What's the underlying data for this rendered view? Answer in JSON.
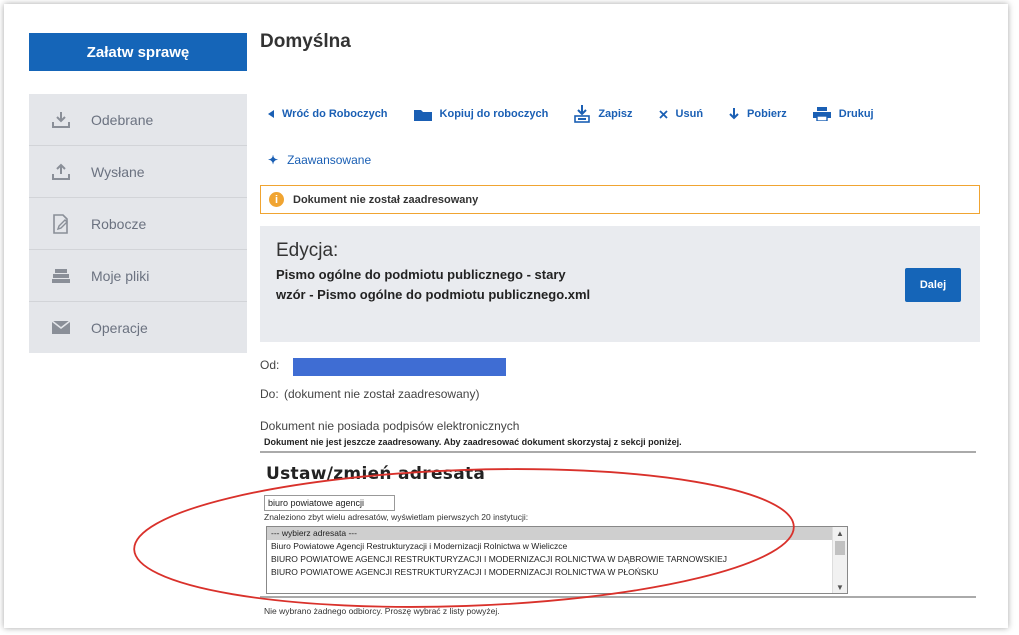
{
  "sidebar": {
    "cta_label": "Załatw sprawę",
    "items": [
      {
        "label": "Odebrane",
        "icon": "download-icon"
      },
      {
        "label": "Wysłane",
        "icon": "upload-icon"
      },
      {
        "label": "Robocze",
        "icon": "draft-edit-icon"
      },
      {
        "label": "Moje pliki",
        "icon": "files-stack-icon"
      },
      {
        "label": "Operacje",
        "icon": "envelope-icon"
      }
    ]
  },
  "page": {
    "title": "Domyślna"
  },
  "toolbar": {
    "back": "Wróć do Roboczych",
    "copy": "Kopiuj do roboczych",
    "save": "Zapisz",
    "delete": "Usuń",
    "download": "Pobierz",
    "print": "Drukuj"
  },
  "advanced": "Zaawansowane",
  "alert": "Dokument nie został zaadresowany",
  "edit": {
    "heading": "Edycja:",
    "document_name": "Pismo ogólne do podmiotu publicznego - stary wzór - Pismo ogólne do podmiotu publicznego.xml",
    "next_button": "Dalej"
  },
  "meta": {
    "from_label": "Od:",
    "to_label": "Do:",
    "to_value": "(dokument nie został zaadresowany)",
    "signatures": "Dokument nie posiada podpisów elektronicznych"
  },
  "form": {
    "notice": "Dokument nie jest jeszcze zaadresowany. Aby zaadresować dokument skorzystaj z sekcji poniżej.",
    "heading": "Ustaw/zmień adresata",
    "search_value": "biuro powiatowe agencji",
    "found_text": "Znaleziono zbyt wielu adresatów, wyświetlam pierwszych 20 instytucji:",
    "options": [
      "--- wybierz adresata ---",
      "Biuro Powiatowe Agencji Restrukturyzacji i Modernizacji Rolnictwa w Wieliczce",
      "BIURO POWIATOWE AGENCJI RESTRUKTURYZACJI I MODERNIZACJI ROLNICTWA W DĄBROWIE TARNOWSKIEJ",
      "BIURO POWIATOWE AGENCJI RESTRUKTURYZACJI I MODERNIZACJI ROLNICTWA W PŁOŃSKU"
    ],
    "none_selected": "Nie wybrano żadnego odbiorcy. Proszę wybrać z listy powyżej."
  },
  "colors": {
    "primary": "#1565b8",
    "link": "#1a5fb4",
    "alert_border": "#f0a431",
    "annotation": "#d9312b",
    "redaction": "#3f6dd3"
  }
}
